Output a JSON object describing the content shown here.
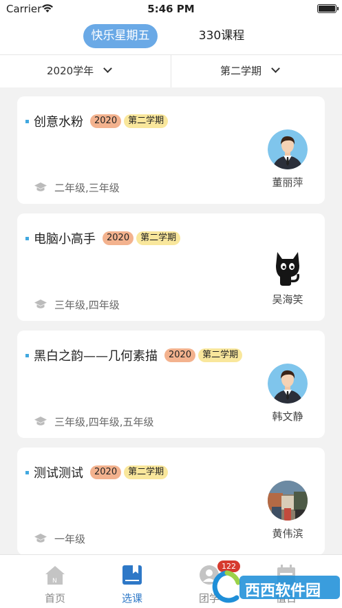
{
  "status_bar": {
    "carrier": "Carrier",
    "time": "5:46 PM"
  },
  "top_tabs": [
    {
      "label": "快乐星期五",
      "active": true
    },
    {
      "label": "330课程",
      "active": false
    }
  ],
  "filters": {
    "year": "2020学年",
    "term": "第二学期"
  },
  "courses": [
    {
      "title": "创意水粉",
      "year": "2020",
      "term": "第二学期",
      "grades": "二年级,三年级",
      "teacher": "董丽萍",
      "avatar": "man-avatar-icon"
    },
    {
      "title": "电脑小高手",
      "year": "2020",
      "term": "第二学期",
      "grades": "三年级,四年级",
      "teacher": "吴海笑",
      "avatar": "black-cat-icon"
    },
    {
      "title": "黑白之韵——几何素描",
      "year": "2020",
      "term": "第二学期",
      "grades": "三年级,四年级,五年级",
      "teacher": "韩文静",
      "avatar": "man-avatar-icon"
    },
    {
      "title": "测试测试",
      "year": "2020",
      "term": "第二学期",
      "grades": "一年级",
      "teacher": "黄伟滨",
      "avatar": "photo-avatar"
    }
  ],
  "tab_bar": [
    {
      "label": "首页",
      "icon": "home-icon",
      "active": false
    },
    {
      "label": "选课",
      "icon": "bookmark-book-icon",
      "active": true
    },
    {
      "label": "团学",
      "icon": "group-icon",
      "active": false,
      "badge": "122"
    },
    {
      "label": "值日",
      "icon": "calendar-icon",
      "active": false
    }
  ],
  "watermark": {
    "text": "西西软件园"
  },
  "colors": {
    "accent": "#6aa9e6",
    "active_tab": "#2e78c7",
    "year_badge": "#f3b28e",
    "term_badge": "#f9e79c",
    "marker": "#41a8e0",
    "notification": "#d63a2e"
  }
}
